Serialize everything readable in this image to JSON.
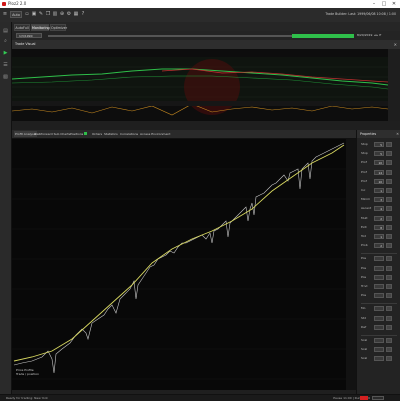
{
  "window": {
    "title": "Ploz2 2.0",
    "controls": [
      "–",
      "□",
      "✕"
    ]
  },
  "toolbar": {
    "auto_label": "Auto",
    "buttons": [
      "tool-a-icon",
      "tool-b-icon",
      "tool-c-icon",
      "tool-d-icon",
      "tool-e-icon",
      "tool-f-icon",
      "tool-g-icon",
      "tool-h-icon",
      "tool-i-icon",
      "tool-j-icon"
    ],
    "status": "Trade Builder: Last: 1999/06/08 10:08 / 1:00"
  },
  "tabs": [
    {
      "label": "AutoFull",
      "active": false
    },
    {
      "label": "Monitoring",
      "active": true
    },
    {
      "label": "Optimizer",
      "active": false
    }
  ],
  "date_range": {
    "start": "1/3/1990",
    "end": "8/20/2019"
  },
  "top_panel": {
    "title": "Trade Visual",
    "close": "✕"
  },
  "mid_tabs": [
    {
      "label": "Profit Analysis",
      "active": true
    },
    {
      "label": "Walkforward Sub Charts",
      "active": false
    },
    {
      "label": "Positions",
      "active": false,
      "checked": true
    },
    {
      "label": "Orders",
      "active": false
    },
    {
      "label": "Statistics",
      "active": false
    },
    {
      "label": "Correlations",
      "active": false
    },
    {
      "label": "Access Environment",
      "active": false
    }
  ],
  "main_chart": {
    "legend": [
      "Price Profile",
      "Trade / position"
    ]
  },
  "right_panel": {
    "title": "Properties",
    "rows": [
      {
        "label": "Stop",
        "value": "5"
      },
      {
        "label": "Stop",
        "value": "5"
      },
      {
        "label": "Prof",
        "value": "10"
      },
      {
        "label": "Prof",
        "value": "14"
      },
      {
        "label": "Prof",
        "value": "10"
      },
      {
        "label": "Inc",
        "value": "1"
      },
      {
        "label": "Minim",
        "value": "3"
      },
      {
        "label": "Ascent",
        "value": "4"
      },
      {
        "label": "Mult",
        "value": "2"
      },
      {
        "label": "Exit",
        "value": "8"
      },
      {
        "label": "Tod",
        "value": "1"
      },
      {
        "label": "Prob",
        "value": "2"
      },
      {
        "label": "Pos",
        "value": ""
      },
      {
        "label": "Pos",
        "value": ""
      },
      {
        "label": "Pos",
        "value": ""
      },
      {
        "label": "Trnd",
        "value": ""
      },
      {
        "label": "Pos",
        "value": ""
      },
      {
        "label": "Mo",
        "value": ""
      },
      {
        "label": "Std",
        "value": ""
      },
      {
        "label": "Def",
        "value": ""
      },
      {
        "label": "Scal",
        "value": ""
      },
      {
        "label": "Scal",
        "value": ""
      },
      {
        "label": "Scal",
        "value": ""
      }
    ]
  },
  "statusbar": {
    "left": "Ready for trading: New York",
    "right": "Pause 11:00 | Run 15:30"
  },
  "colors": {
    "equity_line": "#d8d860",
    "price_line": "#c8c8c8",
    "accent_green": "#2fbf4a",
    "accent_red": "#d42020"
  }
}
